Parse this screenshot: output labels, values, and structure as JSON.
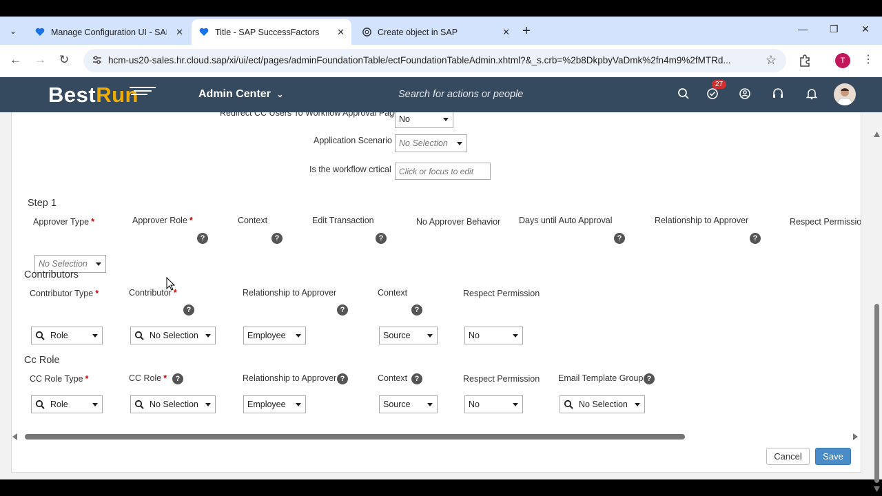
{
  "browser": {
    "tabs": [
      {
        "title": "Manage Configuration UI - SAP",
        "favicon": "sap-heart-icon"
      },
      {
        "title": "Title - SAP SuccessFactors",
        "favicon": "sap-heart-icon"
      },
      {
        "title": "Create object in SAP",
        "favicon": "openai-icon"
      }
    ],
    "active_tab": 1,
    "url": "hcm-us20-sales.hr.cloud.sap/xi/ui/ect/pages/adminFoundationTable/ectFoundationTableAdmin.xhtml?&_s.crb=%2b8DkpbyVaDmk%2fn4m9%2fMTRd...",
    "profile_initial": "T"
  },
  "shell": {
    "logo_best": "Best",
    "logo_run": "Run",
    "title": "Admin Center",
    "search_placeholder": "Search for actions or people",
    "notification_count": "27"
  },
  "form": {
    "redirect_label": "Redirect CC Users To Workflow Approval Page",
    "redirect_value": "No",
    "app_scenario_label": "Application Scenario",
    "app_scenario_value": "No Selection",
    "critical_label": "Is the workflow crtical",
    "critical_placeholder": "Click or focus to edit"
  },
  "step1": {
    "title": "Step 1",
    "columns": [
      "Approver Type",
      "Approver Role",
      "Context",
      "Edit Transaction",
      "No Approver Behavior",
      "Days until Auto Approval",
      "Relationship to Approver",
      "Respect Permission"
    ],
    "approver_type_value": "No Selection"
  },
  "contributors": {
    "title": "Contributors",
    "columns": [
      "Contributor Type",
      "Contributor",
      "Relationship to Approver",
      "Context",
      "Respect Permission"
    ],
    "values": [
      "Role",
      "No Selection",
      "Employee",
      "Source",
      "No"
    ]
  },
  "cc_role": {
    "title": "Cc Role",
    "columns": [
      "CC Role Type",
      "CC Role",
      "Relationship to Approver",
      "Context",
      "Respect Permission",
      "Email Template Group"
    ],
    "values": [
      "Role",
      "No Selection",
      "Employee",
      "Source",
      "No",
      "No Selection"
    ]
  },
  "actions": {
    "cancel": "Cancel",
    "save": "Save"
  }
}
